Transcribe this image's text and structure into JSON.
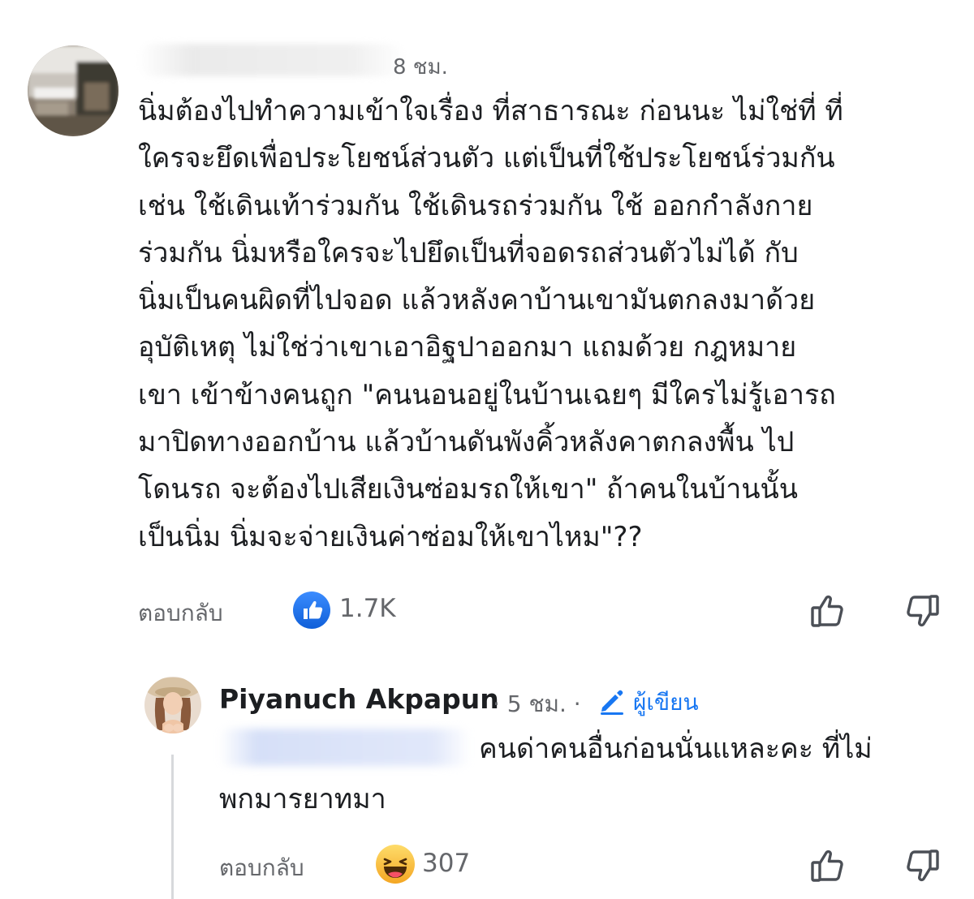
{
  "comment": {
    "timestamp": "8 ชม.",
    "lines": [
      "นิ่มต้องไปทำความเข้าใจเรื่อง ที่สาธารณะ ก่อนนะ ไม่ใช่ที่ ที่",
      "ใครจะยึดเพื่อประโยชน์ส่วนตัว แต่เป็นที่ใช้ประโยชน์ร่วมกัน",
      "เช่น ใช้เดินเท้าร่วมกัน ใช้เดินรถร่วมกัน ใช้ ออกกำลังกาย",
      "ร่วมกัน นิ่มหรือใครจะไปยึดเป็นที่จอดรถส่วนตัวไม่ได้ กับ",
      "นิ่มเป็นคนผิดที่ไปจอด แล้วหลังคาบ้านเขามันตกลงมาด้วย",
      "อุบัติเหตุ ไม่ใช่ว่าเขาเอาอิฐปาออกมา แถมด้วย กฎหมาย",
      "เขา เข้าข้างคนถูก \"คนนอนอยู่ในบ้านเฉยๆ มีใครไม่รู้เอารถ",
      "มาปิดทางออกบ้าน แล้วบ้านดันพังคิ้วหลังคาตกลงพื้น ไป",
      "โดนรถ จะต้องไปเสียเงินซ่อมรถให้เขา\" ถ้าคนในบ้านนั้น",
      "เป็นนิ่ม นิ่มจะจ่ายเงินค่าซ่อมให้เขาไหม\"??"
    ],
    "reply_label": "ตอบกลับ",
    "reaction_icon": "like-icon",
    "reaction_count": "1.7K"
  },
  "reply": {
    "author": "Piyanuch Akpapun",
    "meta": "· 5 ชม. ·",
    "author_badge": "ผู้เขียน",
    "lines": [
      "คนด่าคนอื่นก่อนนั่นแหละคะ ที่ไม่",
      "พกมารยาทมา"
    ],
    "reply_label": "ตอบกลับ",
    "reaction_icon": "haha-icon",
    "reaction_count": "307"
  },
  "colors": {
    "text": "#1c1e21",
    "secondary": "#65676b",
    "accent": "#1877f2",
    "haha": "#f7b125"
  }
}
